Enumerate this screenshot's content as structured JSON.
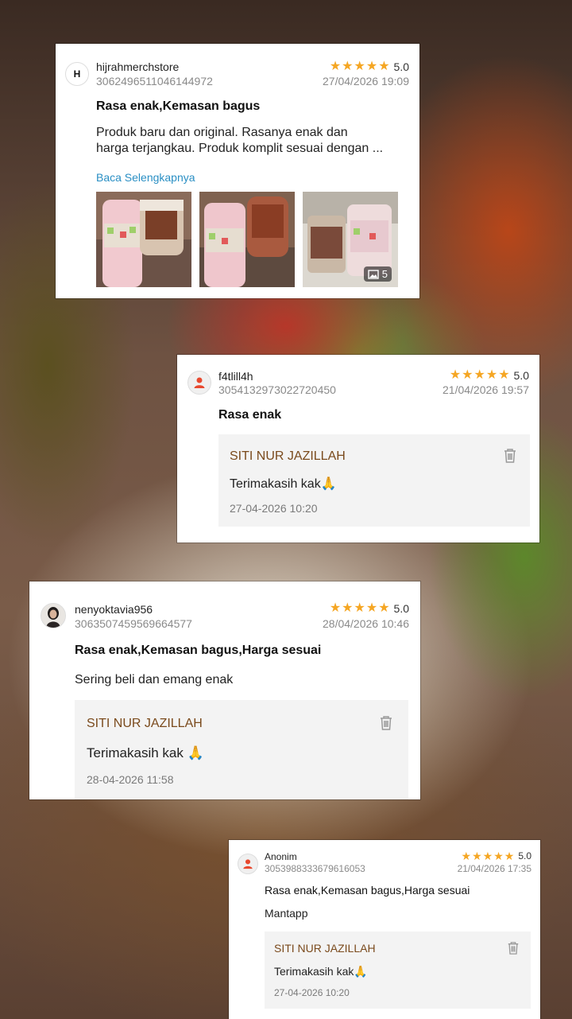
{
  "reviews": [
    {
      "username": "hijrahmerchstore",
      "order_id": "3062496511046144972",
      "stars": "★★★★★",
      "rating": "5.0",
      "date": "27/04/2026 19:09",
      "title": "Rasa enak,Kemasan bagus",
      "text_line1": "Produk baru dan original. Rasanya enak dan",
      "text_line2": "harga terjangkau. Produk komplit sesuai dengan ...",
      "read_more": "Baca Selengkapnya",
      "photo_count": "5",
      "avatar_text": "H"
    },
    {
      "username": "f4tlill4h",
      "order_id": "3054132973022720450",
      "stars": "★★★★★",
      "rating": "5.0",
      "date": "21/04/2026 19:57",
      "title": "Rasa enak",
      "reply_name": "SITI NUR JAZILLAH",
      "reply_text": "Terimakasih kak🙏",
      "reply_date": "27-04-2026 10:20"
    },
    {
      "username": "nenyoktavia956",
      "order_id": "3063507459569664577",
      "stars": "★★★★★",
      "rating": "5.0",
      "date": "28/04/2026 10:46",
      "title": "Rasa enak,Kemasan bagus,Harga sesuai",
      "text": "Sering beli dan emang enak",
      "reply_name": "SITI NUR JAZILLAH",
      "reply_text": "Terimakasih kak 🙏",
      "reply_date": "28-04-2026 11:58"
    },
    {
      "username": "Anonim",
      "order_id": "3053988333679616053",
      "stars": "★★★★★",
      "rating": "5.0",
      "date": "21/04/2026 17:35",
      "title": "Rasa enak,Kemasan bagus,Harga sesuai",
      "text": "Mantapp",
      "reply_name": "SITI NUR JAZILLAH",
      "reply_text": "Terimakasih kak🙏",
      "reply_date": "27-04-2026 10:20"
    }
  ],
  "colors": {
    "star": "#f5a623",
    "link": "#2a8fc4",
    "reply_name": "#7a4a1c",
    "reply_bg": "#f3f3f3"
  },
  "icons": [
    "store-avatar-icon",
    "default-user-icon",
    "user-photo-avatar-icon",
    "trash-icon",
    "image-stack-icon"
  ]
}
